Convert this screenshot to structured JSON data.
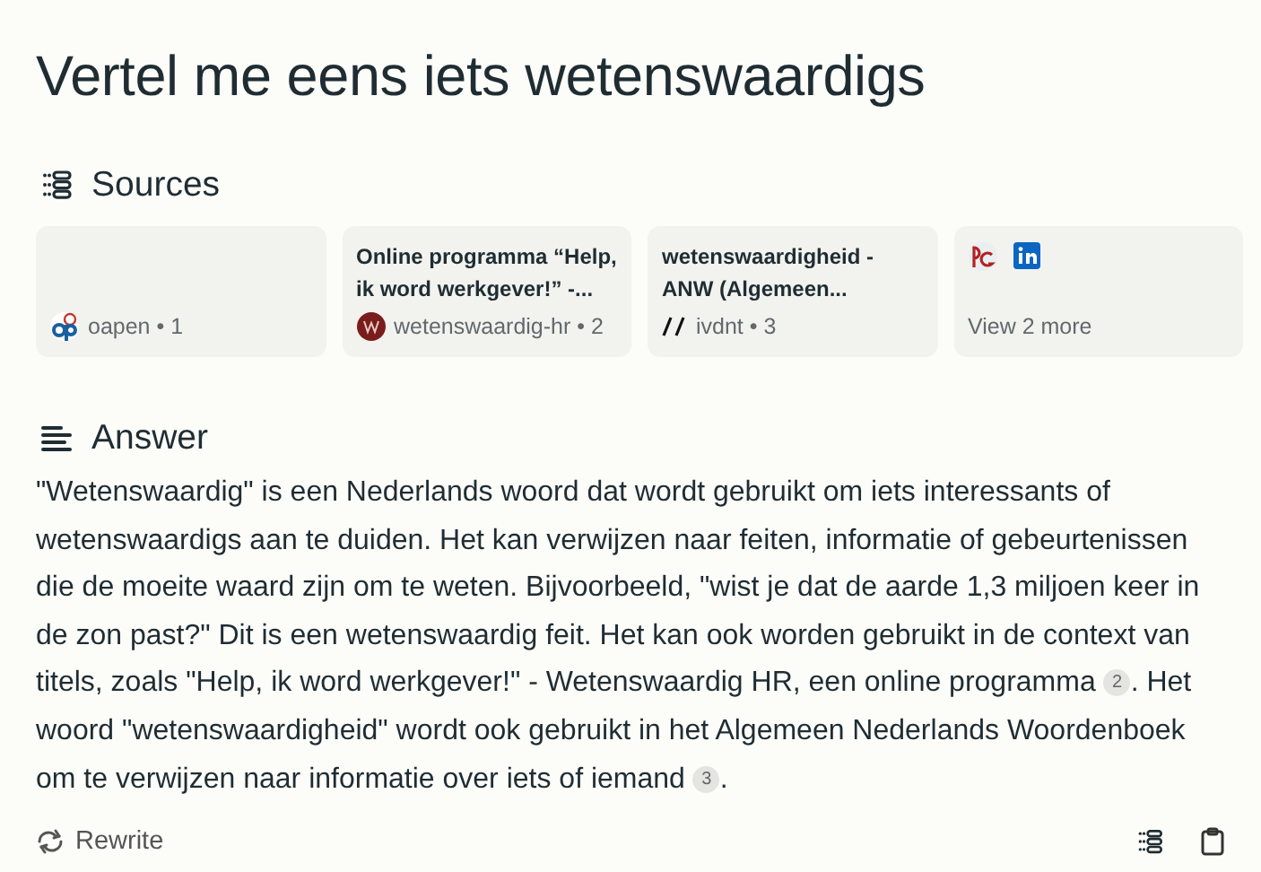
{
  "title": "Vertel me eens iets wetenswaardigs",
  "sources": {
    "heading": "Sources",
    "cards": [
      {
        "kind": "source",
        "site": "oapen • 1"
      },
      {
        "kind": "source",
        "title": "Online programma “Help, ik word werkgever!” -...",
        "site": "wetenswaardig-hr • 2"
      },
      {
        "kind": "source",
        "title": "wetenswaardigheid - ANW (Algemeen...",
        "site": "ivdnt • 3"
      },
      {
        "kind": "more",
        "label": "View 2 more"
      }
    ]
  },
  "answer": {
    "heading": "Answer",
    "segments": [
      {
        "kind": "text",
        "text": "\"Wetenswaardig\" is een Nederlands woord dat wordt gebruikt om iets interessants of wetenswaardigs aan te duiden. Het kan verwijzen naar feiten, informatie of gebeurtenissen die de moeite waard zijn om te weten. Bijvoorbeeld, \"wist je dat de aarde 1,3 miljoen keer in de zon past?\" Dit is een wetenswaardig feit. Het kan ook worden gebruikt in de context van titels, zoals \"Help, ik word werkgever!\" - Wetenswaardig HR, een online programma"
      },
      {
        "kind": "citation",
        "text": "2"
      },
      {
        "kind": "text",
        "text": ". Het woord \"wetenswaardigheid\" wordt ook gebruikt in het Algemeen Nederlands Woordenboek om te verwijzen naar informatie over iets of iemand"
      },
      {
        "kind": "citation",
        "text": "3"
      },
      {
        "kind": "text",
        "text": "."
      }
    ]
  },
  "footer": {
    "rewrite": "Rewrite"
  }
}
